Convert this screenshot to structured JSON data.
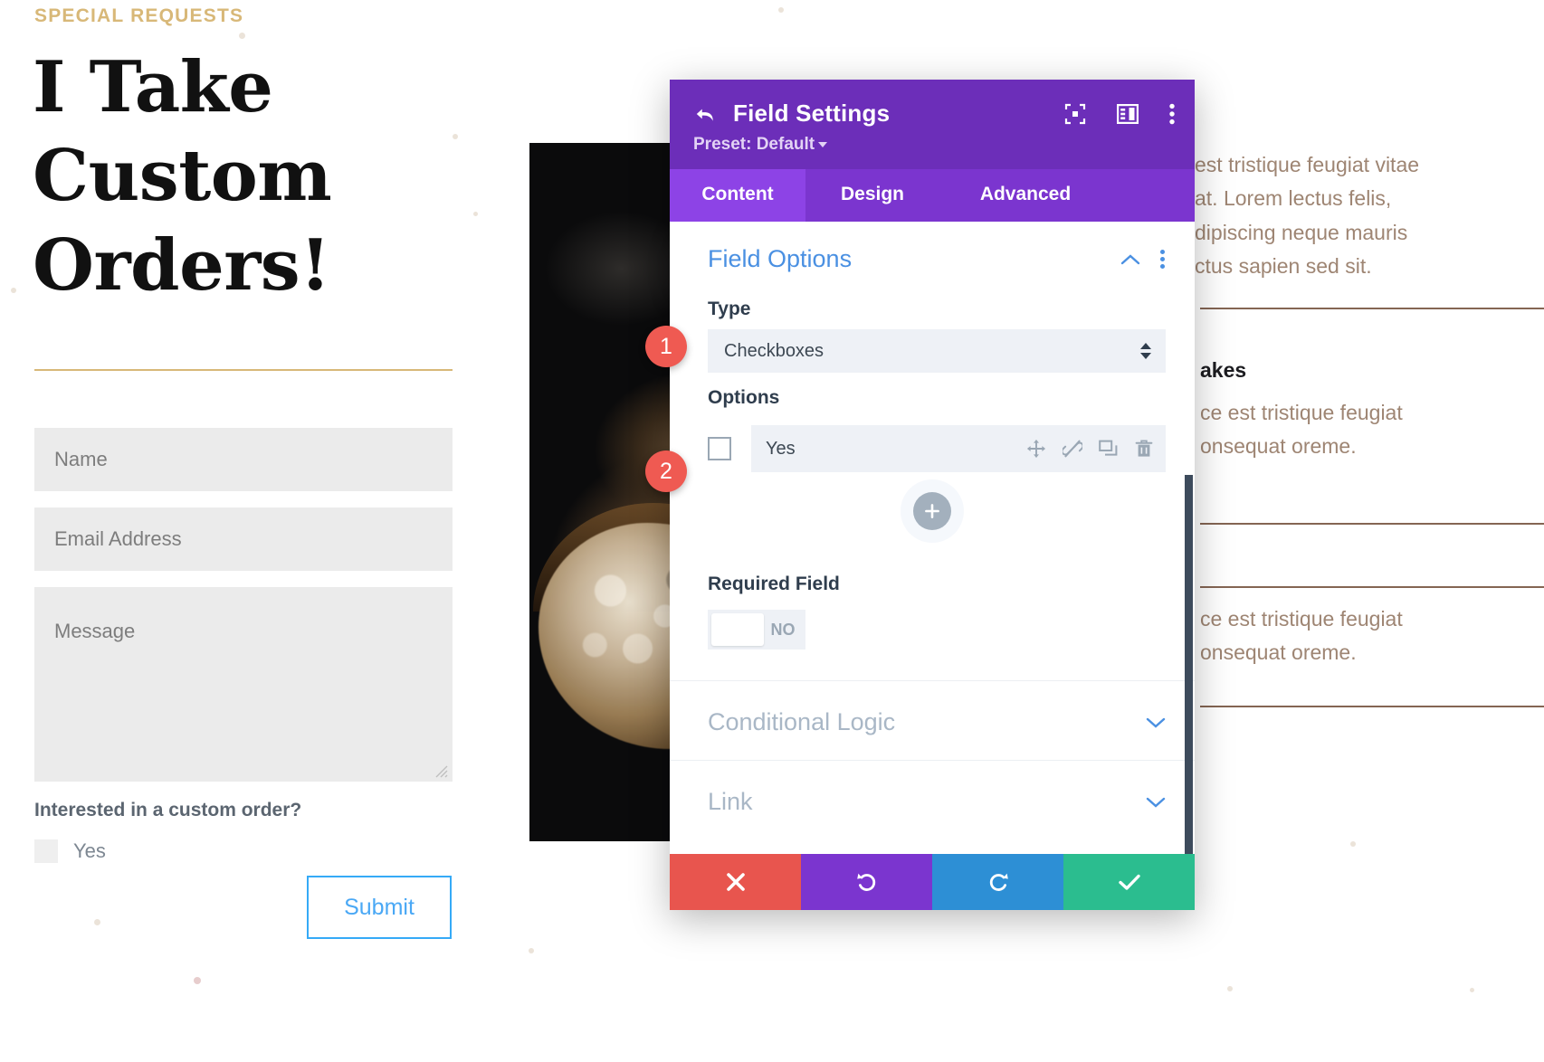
{
  "site": {
    "eyebrow": "SPECIAL REQUESTS",
    "headline": "I Take Custom Orders!",
    "form": {
      "name_placeholder": "Name",
      "email_placeholder": "Email Address",
      "message_placeholder": "Message",
      "checkbox_question": "Interested in a custom order?",
      "checkbox_option": "Yes",
      "submit_label": "Submit"
    },
    "right_column": {
      "paragraph_top": "est tristique feugiat vitae\nat. Lorem lectus felis,\ndipiscing neque mauris\nctus sapien sed sit.",
      "card_title": "akes",
      "card_body_1": "ce est tristique feugiat\nonsequat oreme.",
      "card_body_2": "ce est tristique feugiat\nonsequat oreme."
    }
  },
  "modal": {
    "title": "Field Settings",
    "preset_label": "Preset: Default",
    "header_icons": [
      "focus-icon",
      "layout-panel-icon",
      "kebab-menu-icon"
    ],
    "tabs": [
      {
        "label": "Content",
        "active": true
      },
      {
        "label": "Design",
        "active": false
      },
      {
        "label": "Advanced",
        "active": false
      }
    ],
    "sections": {
      "field_options": {
        "title": "Field Options",
        "type_label": "Type",
        "type_value": "Checkboxes",
        "options_label": "Options",
        "options": [
          {
            "label": "Yes",
            "checked": false,
            "icons": [
              "move-icon",
              "disconnect-icon",
              "duplicate-icon",
              "delete-icon"
            ]
          }
        ],
        "add_option_icon": "plus-icon",
        "required_label": "Required Field",
        "required_state": "NO"
      },
      "conditional_logic": {
        "title": "Conditional Logic"
      },
      "link": {
        "title": "Link"
      }
    },
    "footer_buttons": [
      {
        "name": "cancel",
        "icon": "close-icon",
        "color": "#e8554e"
      },
      {
        "name": "undo",
        "icon": "undo-icon",
        "color": "#7b35cf"
      },
      {
        "name": "redo",
        "icon": "redo-icon",
        "color": "#2d8fd5"
      },
      {
        "name": "save",
        "icon": "check-icon",
        "color": "#2bbd8f"
      }
    ]
  },
  "callouts": [
    {
      "number": "1",
      "target": "type-select"
    },
    {
      "number": "2",
      "target": "option-row"
    }
  ],
  "colors": {
    "brand_purple": "#6c2eb9",
    "tab_purple": "#7b35cf",
    "tab_active": "#8d43e6",
    "accent_blue": "#4a90e2",
    "gold": "#d8b878",
    "callout_red": "#ef5a52"
  }
}
